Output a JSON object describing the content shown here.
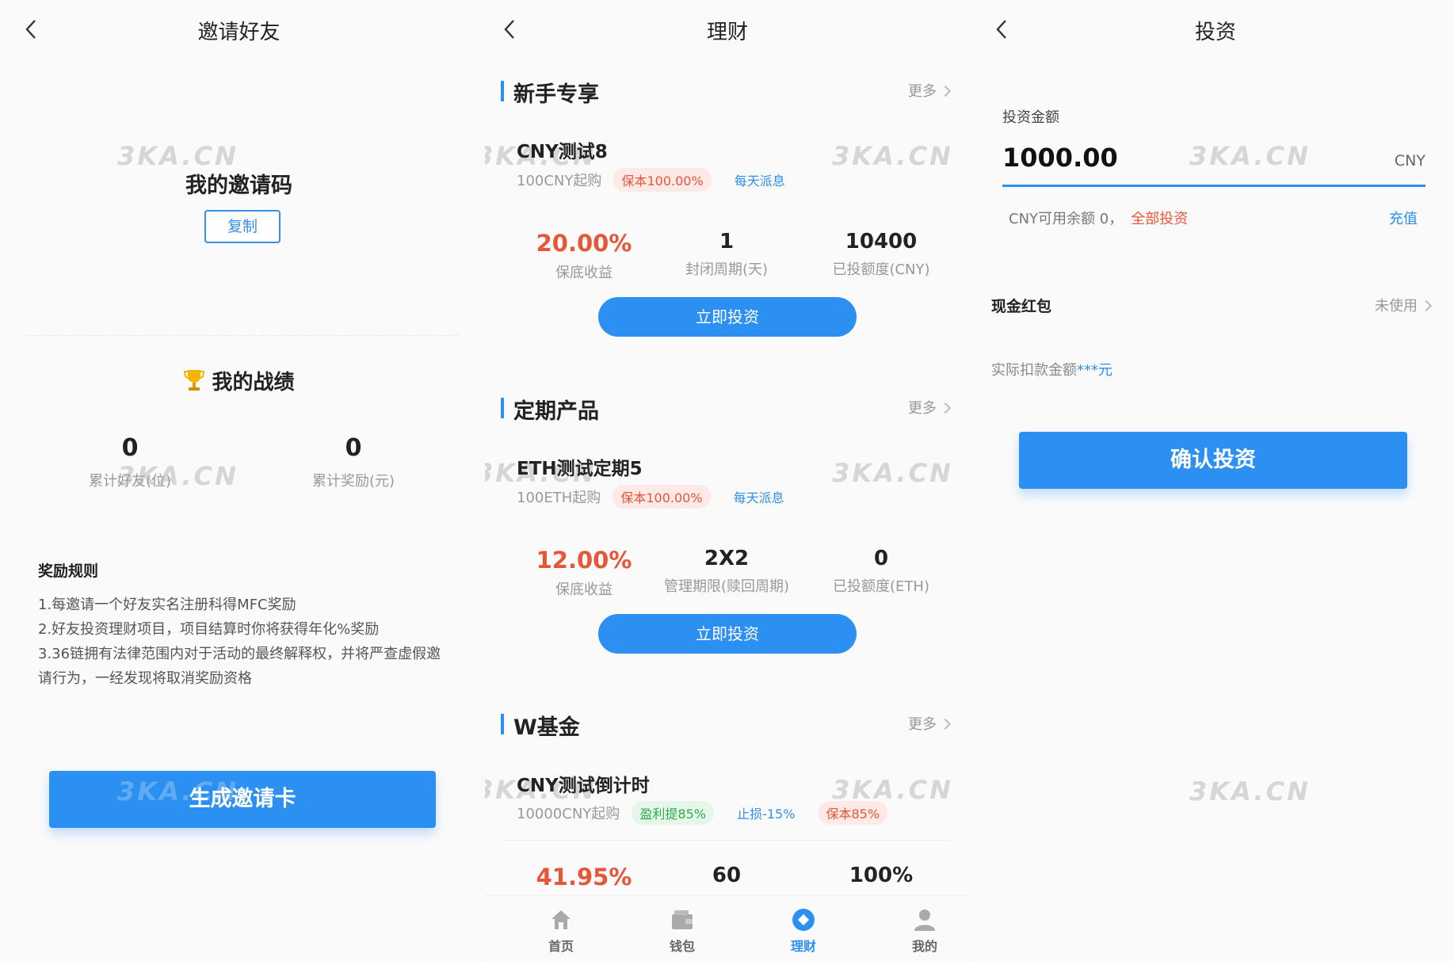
{
  "invite": {
    "title": "邀请好友",
    "invite_code_title": "我的邀请码",
    "copy_label": "复制",
    "record_title": "我的战绩",
    "stats": [
      {
        "value": "0",
        "label": "累计好友(位)"
      },
      {
        "value": "0",
        "label": "累计奖励(元)"
      }
    ],
    "rules_title": "奖励规则",
    "rules": [
      "1.每邀请一个好友实名注册科得MFC奖励",
      "2.好友投资理财项目，项目结算时你将获得年化%奖励",
      "3.36链拥有法律范围内对于活动的最终解释权，并将严查虚假邀请行为，一经发现将取消奖励资格"
    ],
    "generate_label": "生成邀请卡"
  },
  "finance": {
    "title": "理财",
    "more_label": "更多",
    "sections": [
      {
        "title": "新手专享",
        "product": {
          "name": "CNY测试8",
          "min_buy": "100CNY起购",
          "tags": [
            {
              "text": "保本100.00%",
              "style": "red"
            },
            {
              "text": "每天派息",
              "style": "blue"
            }
          ],
          "metrics": [
            {
              "value": "20.00%",
              "label": "保底收益",
              "highlight": true
            },
            {
              "value": "1",
              "label": "封闭周期(天)"
            },
            {
              "value": "10400",
              "label": "已投额度(CNY)"
            }
          ],
          "button": "立即投资"
        }
      },
      {
        "title": "定期产品",
        "product": {
          "name": "ETH测试定期5",
          "min_buy": "100ETH起购",
          "tags": [
            {
              "text": "保本100.00%",
              "style": "red"
            },
            {
              "text": "每天派息",
              "style": "blue"
            }
          ],
          "metrics": [
            {
              "value": "12.00%",
              "label": "保底收益",
              "highlight": true
            },
            {
              "value": "2X2",
              "label": "管理期限(赎回周期)"
            },
            {
              "value": "0",
              "label": "已投额度(ETH)"
            }
          ],
          "button": "立即投资"
        }
      },
      {
        "title": "W基金",
        "product": {
          "name": "CNY测试倒计时",
          "min_buy": "10000CNY起购",
          "tags": [
            {
              "text": "盈利提85%",
              "style": "green"
            },
            {
              "text": "止损-15%",
              "style": "plainblue"
            },
            {
              "text": "保本85%",
              "style": "red"
            }
          ],
          "metrics": [
            {
              "value": "41.95%",
              "highlight": true
            },
            {
              "value": "60"
            },
            {
              "value": "100%"
            }
          ]
        }
      }
    ],
    "tabs": [
      {
        "label": "首页",
        "icon": "home-icon"
      },
      {
        "label": "钱包",
        "icon": "wallet-icon"
      },
      {
        "label": "理财",
        "icon": "finance-icon",
        "active": true
      },
      {
        "label": "我的",
        "icon": "user-icon"
      }
    ]
  },
  "invest": {
    "title": "投资",
    "amount_label": "投资金额",
    "amount_value": "1000.00",
    "amount_unit": "CNY",
    "balance_text": "CNY可用余额 0，",
    "all_invest": "全部投资",
    "recharge": "充值",
    "redpack_label": "现金红包",
    "redpack_status": "未使用",
    "deduct_text": "实际扣款金额",
    "deduct_value": "***元",
    "confirm_label": "确认投资"
  },
  "watermark": "3KA.CN",
  "colors": {
    "accent": "#2c8ff2",
    "highlight": "#e8563a",
    "success": "#2fae4a"
  }
}
